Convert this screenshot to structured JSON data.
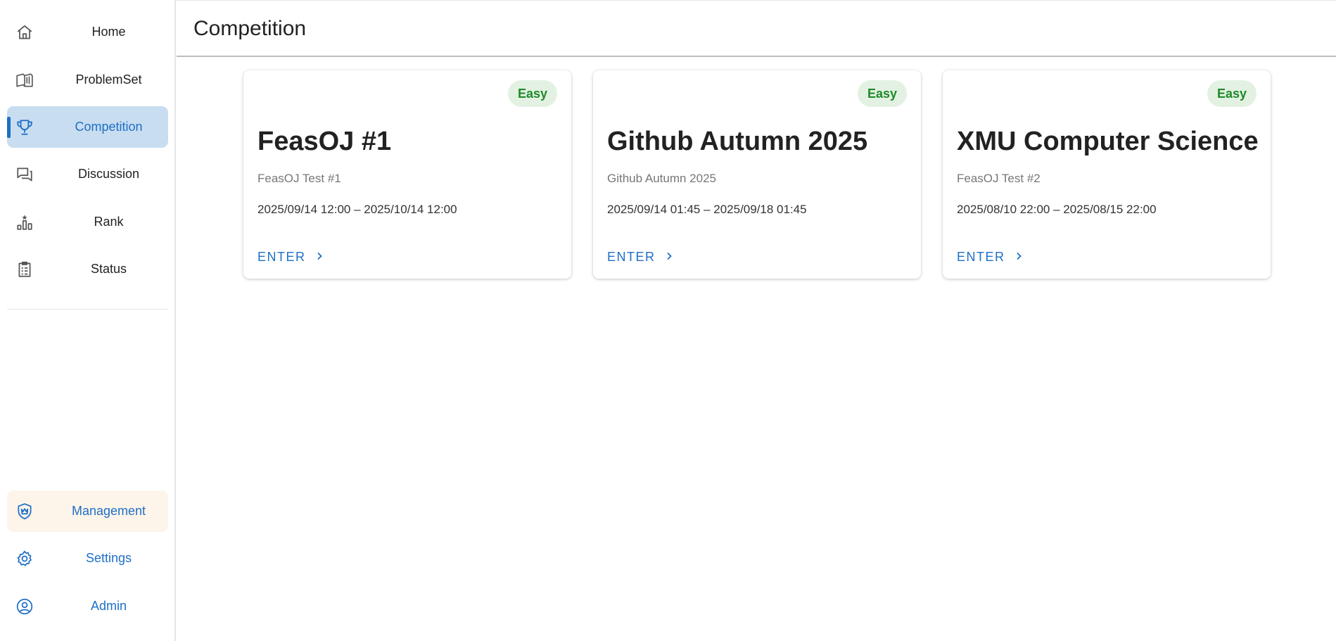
{
  "page": {
    "title": "Competition"
  },
  "sidebar": {
    "items": [
      {
        "label": "Home",
        "icon": "home-icon"
      },
      {
        "label": "ProblemSet",
        "icon": "book-icon"
      },
      {
        "label": "Competition",
        "icon": "trophy-icon",
        "active": true
      },
      {
        "label": "Discussion",
        "icon": "chat-icon"
      },
      {
        "label": "Rank",
        "icon": "rank-chart-icon"
      },
      {
        "label": "Status",
        "icon": "clipboard-icon"
      }
    ],
    "bottom": [
      {
        "label": "Management",
        "icon": "shield-crown-icon"
      },
      {
        "label": "Settings",
        "icon": "gear-icon"
      },
      {
        "label": "Admin",
        "icon": "user-circle-icon"
      }
    ]
  },
  "competitions": [
    {
      "title": "FeasOJ #1",
      "subtitle": "FeasOJ Test #1",
      "time": "2025/09/14 12:00 – 2025/10/14 12:00",
      "difficulty": "Easy",
      "action": "ENTER"
    },
    {
      "title": "Github Autumn 2025",
      "subtitle": "Github Autumn 2025",
      "time": "2025/09/14 01:45 – 2025/09/18 01:45",
      "difficulty": "Easy",
      "action": "ENTER"
    },
    {
      "title": "XMU Computer Science",
      "subtitle": "FeasOJ Test #2",
      "time": "2025/08/10 22:00 – 2025/08/15 22:00",
      "difficulty": "Easy",
      "action": "ENTER"
    }
  ],
  "colors": {
    "accent": "#1e6fc6",
    "active_bg": "#c9ddf1",
    "management_bg": "#fdf4ea",
    "easy_badge_bg": "#e3f1e2",
    "easy_badge_text": "#1f8a2a"
  }
}
